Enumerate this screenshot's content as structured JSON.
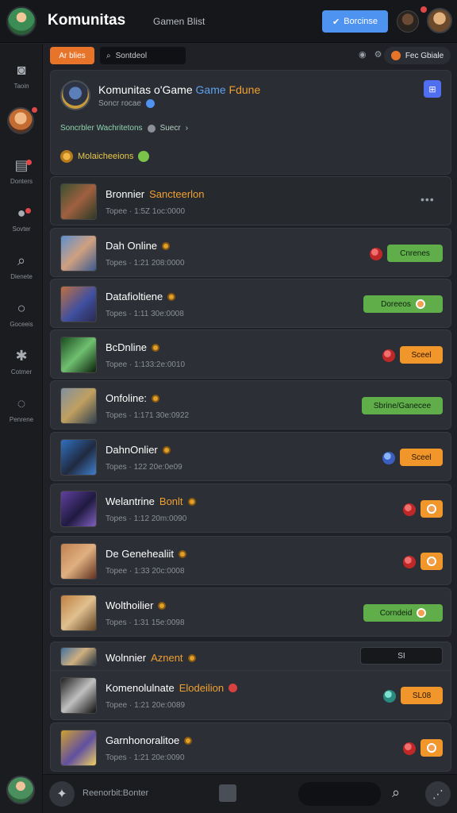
{
  "header": {
    "app_title": "Komunitas",
    "subtitle": "Gamen Blist",
    "primary_button": "Borcinse"
  },
  "toolbar": {
    "chip": "Ar blies",
    "search": "Sontdeol",
    "right_chip": "Fec Gbiale"
  },
  "sidebar": {
    "items": [
      "Taoin",
      "Donters",
      "Sovter",
      "Dienete",
      "Goceeis",
      "Cotmer",
      "Penrene"
    ]
  },
  "community": {
    "title_main": "Komunitas o'Game",
    "title_blue": "Game",
    "title_orange": "Fdune",
    "sub": "Soncr rocae",
    "desc_green": "Soncrbler Wachritetons",
    "desc_grey": "Suecr",
    "tag": "Molaicheeions"
  },
  "games": [
    {
      "name": "Bronnier",
      "highlight": "Sancteerlon",
      "meta": "Topee · 1:5Z 1oc:0000",
      "action": "more"
    },
    {
      "name": "Dah Online",
      "meta": "Topes · 1:21 208:0000",
      "icon": "red",
      "button": "Cnrenes",
      "btn_color": "green"
    },
    {
      "name": "Datafioltiene",
      "meta": "Topes · 1:11 30e:0008",
      "button": "Doreeos",
      "btn_color": "green",
      "btn_circle": true
    },
    {
      "name": "BcDnline",
      "meta": "Topee · 1:133:2e:0010",
      "icon": "red",
      "button": "Sceel",
      "btn_color": "orange"
    },
    {
      "name": "Onfoline:",
      "meta": "Topes · 1:171 30e:0922",
      "button": "Sbrine/Ganecee",
      "btn_color": "green"
    },
    {
      "name": "DahnOnlier",
      "meta": "Topes · 122 20e:0e09",
      "icon": "blue",
      "button": "Sceel",
      "btn_color": "orange"
    },
    {
      "name": "Welantrine",
      "highlight": "Bonlt",
      "meta": "Topes · 1:12 20m:0090",
      "icon": "red",
      "btn_color": "orange",
      "btn_circle": true
    },
    {
      "name": "De Genehealiit",
      "meta": "Topee · 1:33 20c:0008",
      "icon": "red",
      "btn_color": "orange",
      "btn_circle": true
    },
    {
      "name": "Wolthoilier",
      "meta": "Topes · 1:31 15e:0098",
      "button": "Corndeid",
      "btn_color": "green",
      "btn_circle": true
    },
    {
      "name": "Wolnnier",
      "highlight": "Aznent",
      "button": "SI",
      "btn_color": "dark"
    },
    {
      "name": "Komenolulnate",
      "highlight": "Elodeilion",
      "meta": "Topee · 1:21 20e:0089",
      "icon": "teal",
      "button": "SL08",
      "btn_color": "orange"
    },
    {
      "name": "Garnhonoralitoe",
      "meta": "Topes · 1:21 20e:0090",
      "icon": "red",
      "btn_color": "orange",
      "btn_circle": true
    }
  ],
  "bottom": {
    "text": "Reenorbit:Bonter"
  }
}
